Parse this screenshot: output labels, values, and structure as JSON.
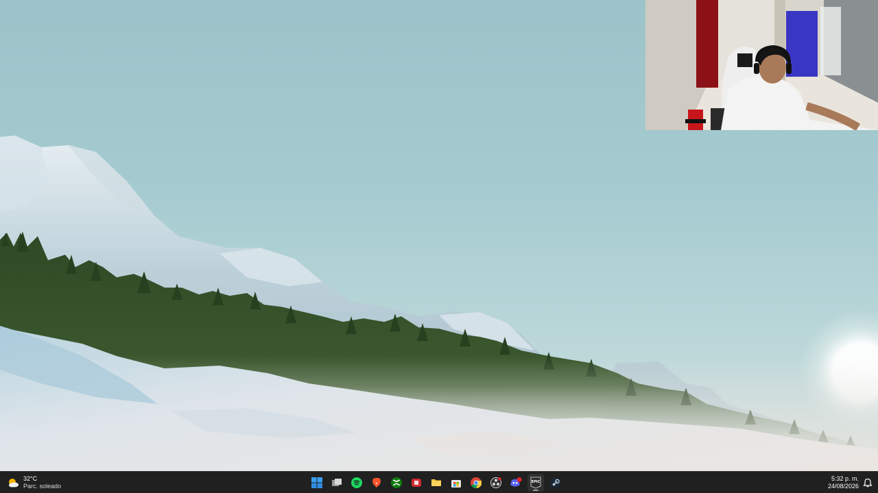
{
  "weather": {
    "temperature": "32°C",
    "condition": "Parc. soleado",
    "icon": "partly-sunny-icon"
  },
  "taskbar": {
    "apps": [
      {
        "name": "start-button",
        "icon": "windows-logo-icon"
      },
      {
        "name": "task-view-button",
        "icon": "task-view-icon"
      },
      {
        "name": "spotify-button",
        "icon": "spotify-icon"
      },
      {
        "name": "brave-button",
        "icon": "brave-icon"
      },
      {
        "name": "xbox-button",
        "icon": "xbox-icon"
      },
      {
        "name": "red-app-button",
        "icon": "red-app-icon"
      },
      {
        "name": "file-explorer-button",
        "icon": "folder-icon"
      },
      {
        "name": "store-button",
        "icon": "store-icon"
      },
      {
        "name": "chrome-button",
        "icon": "chrome-icon"
      },
      {
        "name": "obs-button",
        "icon": "obs-icon"
      },
      {
        "name": "discord-button",
        "icon": "discord-icon",
        "badge": "99"
      },
      {
        "name": "epic-games-button",
        "icon": "epic-games-icon",
        "label": "EPIC"
      },
      {
        "name": "steam-button",
        "icon": "steam-icon"
      }
    ],
    "time": "5:32 p. m.",
    "date": "24/08/2026"
  },
  "colors": {
    "taskbar": "#202020",
    "sky": "#9fc6cc",
    "snow": "#dfe6ea",
    "trees": "#2f4a24"
  }
}
